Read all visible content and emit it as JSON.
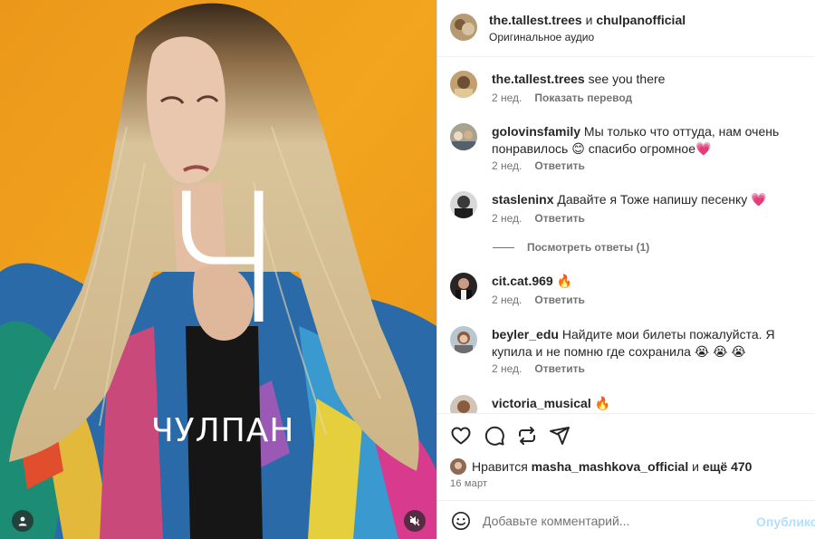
{
  "media": {
    "big_letter": "Ч",
    "artist_name": "ЧУЛПАН",
    "user_icon": "person-icon",
    "mute_icon": "muted-speaker-icon"
  },
  "header": {
    "user1": "the.tallest.trees",
    "conj": "и",
    "user2": "chulpanofficial",
    "subtitle": "Оригинальное аудио"
  },
  "comments": [
    {
      "username": "the.tallest.trees",
      "text": "see you there",
      "time": "2 нед.",
      "action": "Показать перевод"
    },
    {
      "username": "golovinsfamily",
      "text": "Мы только что оттуда, нам очень понравилось 😊 спасибо огромное💗",
      "time": "2 нед.",
      "action": "Ответить"
    },
    {
      "username": "stasleninx",
      "text": "Давайте я Тоже напишу песенку 💗",
      "time": "2 нед.",
      "action": "Ответить"
    },
    {
      "username": "cit.cat.969",
      "text": "🔥",
      "time": "2 нед.",
      "action": "Ответить"
    },
    {
      "username": "beyler_edu",
      "text": "Найдите мои билеты пожалуйста. Я купила и не помню где сохранила 😭 😭 😭",
      "time": "2 нед.",
      "action": "Ответить"
    },
    {
      "username": "victoria_musical",
      "text": "🔥"
    }
  ],
  "view_replies": "Посмотреть ответы (1)",
  "likes": {
    "prefix": "Нравится",
    "user": "masha_mashkova_official",
    "middle": "и",
    "count": "ещё 470"
  },
  "date": "16 март",
  "add_comment": {
    "placeholder": "Добавьте комментарий...",
    "post": "Опубликов"
  },
  "colors": {
    "background_yellow": "#f1a21c",
    "link_disabled": "#b2dffc",
    "secondary_text": "#737373"
  }
}
